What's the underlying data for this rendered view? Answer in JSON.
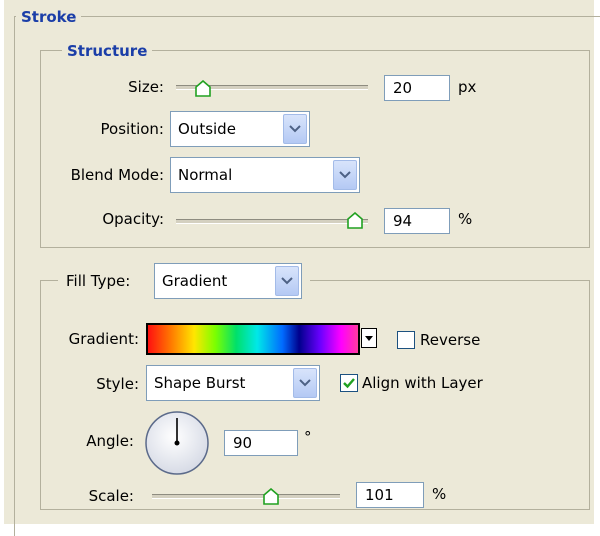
{
  "stroke": {
    "title": "Stroke",
    "structure": {
      "title": "Structure",
      "size": {
        "label": "Size:",
        "value": "20",
        "unit": "px",
        "level": 0.15
      },
      "position": {
        "label": "Position:",
        "value": "Outside"
      },
      "blend_mode": {
        "label": "Blend Mode:",
        "value": "Normal"
      },
      "opacity": {
        "label": "Opacity:",
        "value": "94",
        "unit": "%",
        "level": 0.94
      }
    },
    "fill": {
      "fill_type": {
        "label": "Fill Type:",
        "value": "Gradient"
      },
      "gradient": {
        "label": "Gradient:",
        "reverse_label": "Reverse",
        "reverse_checked": false
      },
      "style": {
        "label": "Style:",
        "value": "Shape Burst",
        "align_label": "Align with Layer",
        "align_checked": true
      },
      "angle": {
        "label": "Angle:",
        "value": "90",
        "unit": "°"
      },
      "scale": {
        "label": "Scale:",
        "value": "101",
        "unit": "%",
        "level": 0.6
      }
    }
  },
  "colors": {
    "legend": "#1b3ea8",
    "panel_bg": "#ece9d8",
    "field_border": "#7f9db9",
    "check_green": "#21a121"
  },
  "icons": {
    "dropdown": "chevron-down-icon",
    "slider_thumb": "slider-thumb-icon",
    "checkmark": "checkmark-icon",
    "angle_dial": "angle-dial-icon"
  }
}
